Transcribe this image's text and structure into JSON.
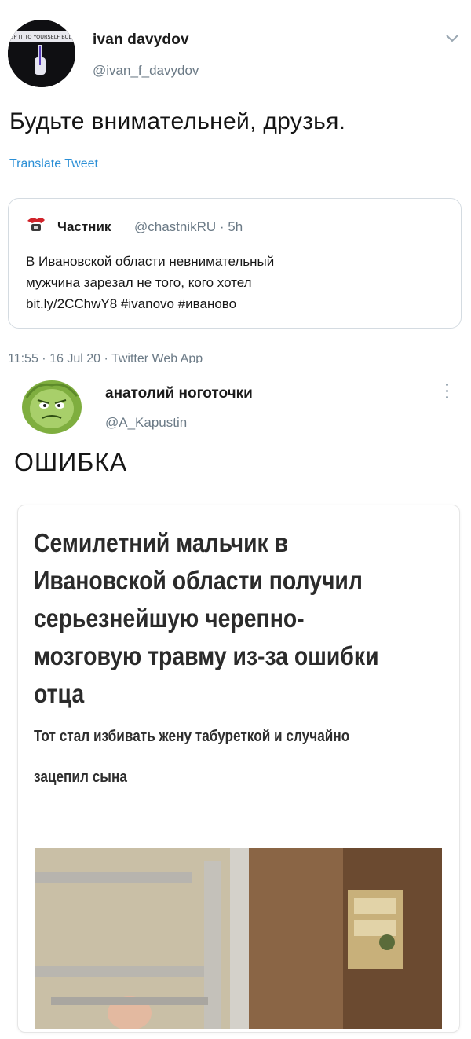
{
  "tweet1": {
    "author_name": "ivan davydov",
    "author_handle": "@ivan_f_davydov",
    "avatar_text": "KEEP IT TO YOURSELF BUDDY",
    "text": "Будьте внимательней, друзья.",
    "translate_label": "Translate Tweet",
    "quoted": {
      "name": "Частник",
      "handle": "@chastnikRU · 5h",
      "lines": [
        "В Ивановской области невнимательный",
        "мужчина зарезал не того, кого хотел",
        "bit.ly/2CChwY8 #ivanovo #иваново"
      ]
    },
    "meta": "11:55 · 16 Jul 20 · Twitter Web App"
  },
  "tweet2": {
    "author_name": "анатолий ноготочки",
    "author_handle": "@A_Kapustin",
    "text": "ОШИБКА",
    "card": {
      "headline_lines": [
        "Семилетний мальчик в",
        "Ивановской области получил",
        "серьезнейшую черепно-",
        "мозговую травму из-за ошибки",
        "отца"
      ],
      "subheadline_lines": [
        "Тот стал избивать жену табуреткой и случайно",
        "зацепил сына"
      ]
    }
  },
  "icons": {
    "chevron": "chevron-down-icon",
    "more": "more-vertical-icon",
    "quote_logo": "chastnik-logo"
  },
  "colors": {
    "link": "#2b8fd6",
    "muted": "#6b7a86",
    "border": "#d4dbe1"
  }
}
